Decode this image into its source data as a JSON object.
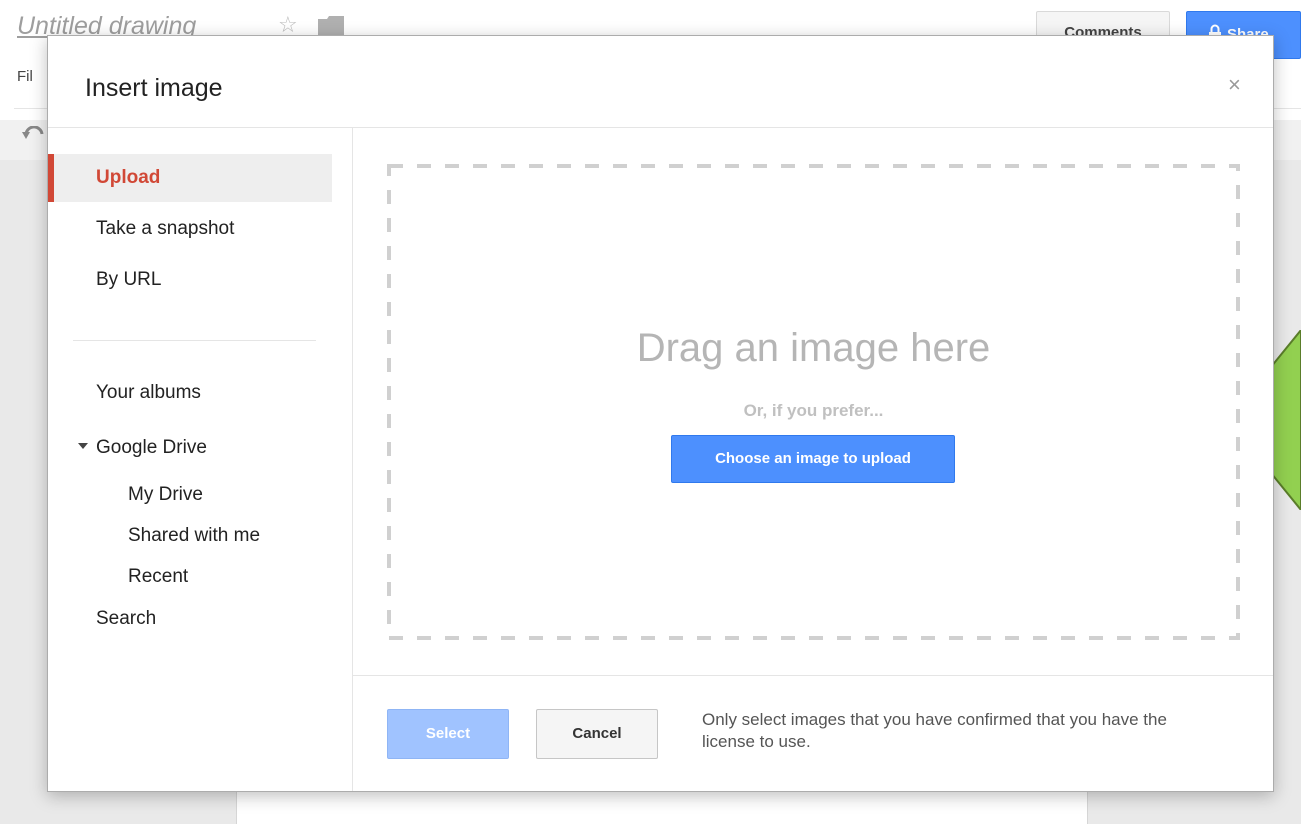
{
  "app": {
    "doc_title": "Untitled drawing",
    "menu_file": "Fil",
    "comments_label": "Comments",
    "share_label": "Share",
    "callout_color": "#92d050"
  },
  "dialog": {
    "title": "Insert image",
    "close_glyph": "×",
    "nav": {
      "upload": "Upload",
      "snapshot": "Take a snapshot",
      "by_url": "By URL",
      "your_albums": "Your albums",
      "google_drive": "Google Drive",
      "my_drive": "My Drive",
      "shared_with_me": "Shared with me",
      "recent": "Recent",
      "search": "Search"
    },
    "drop": {
      "title": "Drag an image here",
      "subtitle": "Or, if you prefer...",
      "choose_label": "Choose an image to upload"
    },
    "footer": {
      "select_label": "Select",
      "cancel_label": "Cancel",
      "license_note": "Only select images that you have confirmed that you have the license to use."
    },
    "colors": {
      "accent_red": "#d14836",
      "primary_blue": "#4d90fe",
      "disabled_blue": "#a0c3ff"
    }
  }
}
